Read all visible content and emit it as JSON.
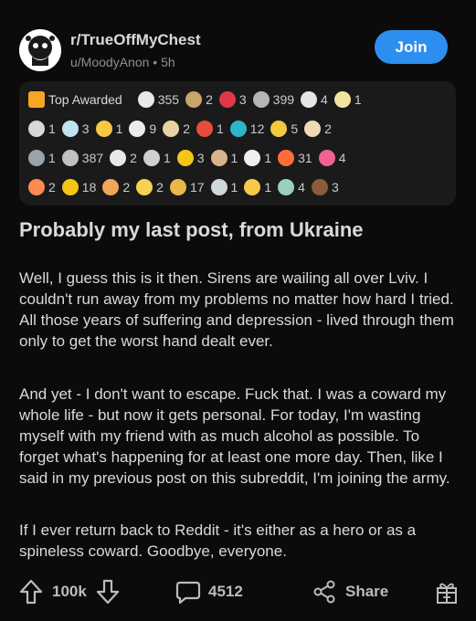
{
  "header": {
    "subreddit": "r/TrueOffMyChest",
    "user": "u/MoodyAnon",
    "separator": "•",
    "time": "5h",
    "join_label": "Join",
    "join_color": "#2c8ff0"
  },
  "awards": {
    "top_label": "Top Awarded",
    "rows": [
      [
        {
          "icon": "trophy-icon",
          "color": "#f5a623",
          "count": ""
        },
        {
          "icon": "wholesome-icon",
          "color": "#e8e8e8",
          "count": "355"
        },
        {
          "icon": "hug-icon",
          "color": "#c9a46b",
          "count": "2"
        },
        {
          "icon": "heart-icon",
          "color": "#e0374a",
          "count": "3"
        },
        {
          "icon": "silver-icon",
          "color": "#b5b5b5",
          "count": "399"
        },
        {
          "icon": "cat-icon",
          "color": "#e6e6e6",
          "count": "4"
        },
        {
          "icon": "angel-icon",
          "color": "#f3e3a0",
          "count": "1"
        }
      ],
      [
        {
          "icon": "snoo-icon",
          "color": "#d8d8d8",
          "count": "1"
        },
        {
          "icon": "angel-face-icon",
          "color": "#bfe3f0",
          "count": "3"
        },
        {
          "icon": "sun-icon",
          "color": "#f7c842",
          "count": "1"
        },
        {
          "icon": "dog-icon",
          "color": "#ececec",
          "count": "9"
        },
        {
          "icon": "hands-icon",
          "color": "#e6d3a3",
          "count": "2"
        },
        {
          "icon": "sparkle-icon",
          "color": "#e74c3c",
          "count": "1"
        },
        {
          "icon": "helpful-icon",
          "color": "#2fb5c9",
          "count": "12"
        },
        {
          "icon": "smile-icon",
          "color": "#f4c93f",
          "count": "5"
        },
        {
          "icon": "wave-icon",
          "color": "#f0d9b5",
          "count": "2"
        }
      ],
      [
        {
          "icon": "moai-icon",
          "color": "#9aa3a8",
          "count": "1"
        },
        {
          "icon": "silver-coin-icon",
          "color": "#c0c0c0",
          "count": "387"
        },
        {
          "icon": "laugh-icon",
          "color": "#e8e8e8",
          "count": "2"
        },
        {
          "icon": "face-icon",
          "color": "#d0d0d0",
          "count": "1"
        },
        {
          "icon": "clap-icon",
          "color": "#f5c518",
          "count": "3"
        },
        {
          "icon": "toast-icon",
          "color": "#d9b38c",
          "count": "1"
        },
        {
          "icon": "goat-icon",
          "color": "#efefef",
          "count": "1"
        },
        {
          "icon": "snoo-face-icon",
          "color": "#ff6d3a",
          "count": "31"
        },
        {
          "icon": "love-icon",
          "color": "#f06292",
          "count": "4"
        }
      ],
      [
        {
          "icon": "rocket-icon",
          "color": "#ff8a50",
          "count": "2"
        },
        {
          "icon": "gold-icon",
          "color": "#f5c518",
          "count": "18"
        },
        {
          "icon": "heart-hug-icon",
          "color": "#f2a65a",
          "count": "2"
        },
        {
          "icon": "party-icon",
          "color": "#f7d154",
          "count": "2"
        },
        {
          "icon": "fist-bump-icon",
          "color": "#e8b84a",
          "count": "17"
        },
        {
          "icon": "ghost-icon",
          "color": "#cfd8dc",
          "count": "1"
        },
        {
          "icon": "yellow-face-icon",
          "color": "#f7c948",
          "count": "1"
        },
        {
          "icon": "crying-icon",
          "color": "#9ad0c2",
          "count": "4"
        },
        {
          "icon": "poop-icon",
          "color": "#8d5a3b",
          "count": "3"
        }
      ]
    ]
  },
  "post": {
    "title": "Probably my last post, from Ukraine",
    "paragraphs": [
      "Well, I guess this is it then. Sirens are wailing all over Lviv. I couldn't run away from my problems no matter how hard I tried. All those years of suffering and depression - lived through them only to get the worst hand dealt ever.",
      "And yet - I don't want to escape. Fuck that. I was a coward my whole life - but now it gets personal. For today, I'm wasting myself with my friend with as much alcohol as possible. To forget what's happening for at least one more day. Then, like I said in my previous post on this subreddit, I'm joining the army.",
      "If I ever return back to Reddit - it's either as a hero or as a spineless coward. Goodbye, everyone."
    ]
  },
  "actions": {
    "upvotes": "100k",
    "comments": "4512",
    "share_label": "Share"
  }
}
